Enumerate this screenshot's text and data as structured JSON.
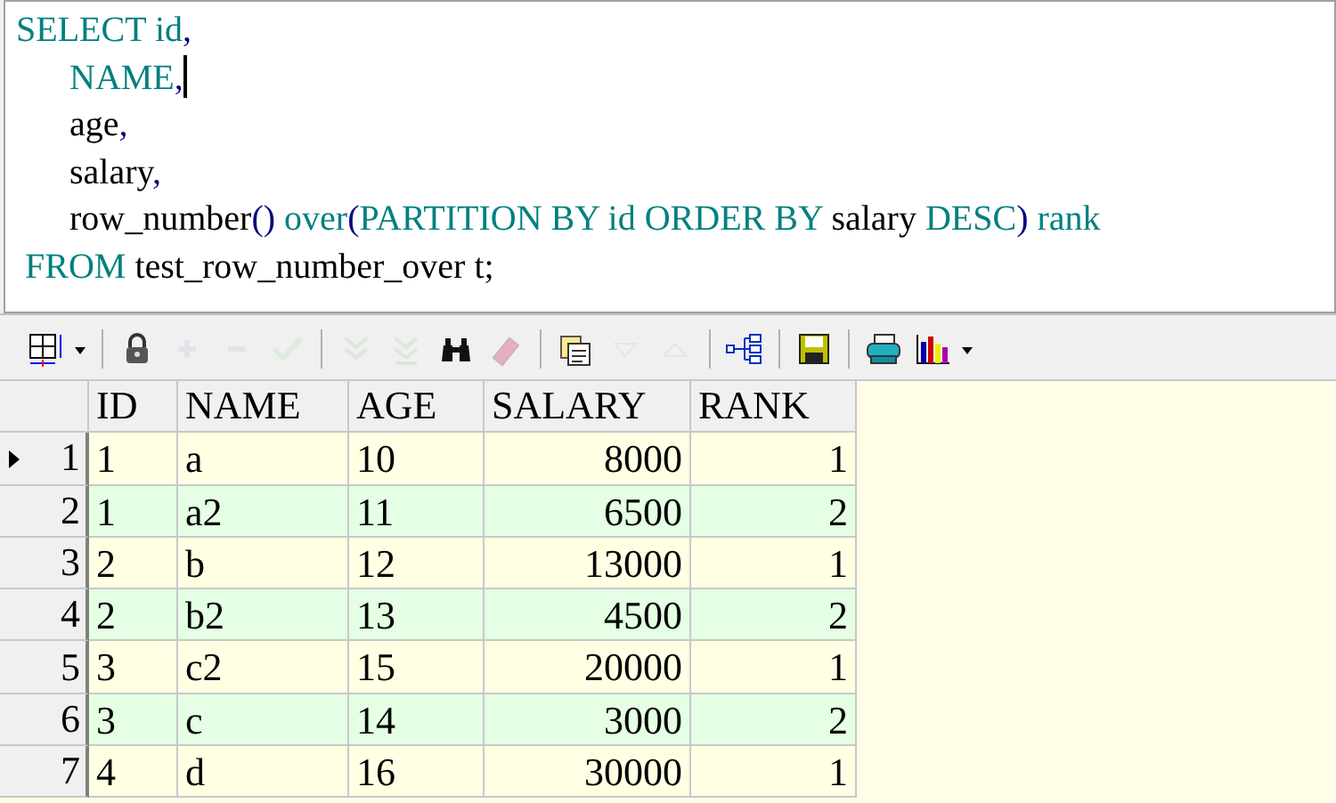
{
  "editor": {
    "lines": [
      {
        "caret": false,
        "tokens": [
          {
            "kind": "keyword",
            "text": "SELECT id"
          },
          {
            "kind": "punct",
            "text": ","
          }
        ]
      },
      {
        "caret": true,
        "tokens": [
          {
            "kind": "keyword",
            "text": "      NAME"
          },
          {
            "kind": "punct",
            "text": ","
          }
        ]
      },
      {
        "caret": false,
        "tokens": [
          {
            "kind": "ident",
            "text": "      age"
          },
          {
            "kind": "punct",
            "text": ","
          }
        ]
      },
      {
        "caret": false,
        "tokens": [
          {
            "kind": "ident",
            "text": "      salary"
          },
          {
            "kind": "punct",
            "text": ","
          }
        ]
      },
      {
        "caret": false,
        "tokens": [
          {
            "kind": "ident",
            "text": "      row_number"
          },
          {
            "kind": "punct",
            "text": "()"
          },
          {
            "kind": "keyword",
            "text": " over"
          },
          {
            "kind": "punct",
            "text": "("
          },
          {
            "kind": "keyword",
            "text": "PARTITION BY id ORDER BY"
          },
          {
            "kind": "ident",
            "text": " salary "
          },
          {
            "kind": "keyword",
            "text": "DESC"
          },
          {
            "kind": "punct",
            "text": ")"
          },
          {
            "kind": "keyword",
            "text": " rank"
          }
        ]
      },
      {
        "caret": false,
        "tokens": [
          {
            "kind": "keyword",
            "text": " FROM"
          },
          {
            "kind": "ident",
            "text": " test_row_number_over t;"
          }
        ]
      }
    ]
  },
  "toolbar": [
    {
      "kind": "grid",
      "disabled": false
    },
    {
      "kind": "dropdown",
      "disabled": false
    },
    {
      "kind": "separator"
    },
    {
      "kind": "lock",
      "disabled": false
    },
    {
      "kind": "plus",
      "disabled": true
    },
    {
      "kind": "minus",
      "disabled": true
    },
    {
      "kind": "check",
      "disabled": true
    },
    {
      "kind": "separator"
    },
    {
      "kind": "chevrons-down",
      "disabled": true
    },
    {
      "kind": "chevrons-down-bar",
      "disabled": true
    },
    {
      "kind": "binoculars",
      "disabled": false
    },
    {
      "kind": "eraser",
      "disabled": true
    },
    {
      "kind": "separator"
    },
    {
      "kind": "documents",
      "disabled": false
    },
    {
      "kind": "triangle-down",
      "disabled": true
    },
    {
      "kind": "triangle-up",
      "disabled": true
    },
    {
      "kind": "separator"
    },
    {
      "kind": "tree",
      "disabled": false
    },
    {
      "kind": "separator"
    },
    {
      "kind": "floppy",
      "disabled": false
    },
    {
      "kind": "separator"
    },
    {
      "kind": "printer",
      "disabled": false
    },
    {
      "kind": "bar-chart",
      "disabled": false
    },
    {
      "kind": "dropdown",
      "disabled": false
    }
  ],
  "table": {
    "columns": [
      {
        "label": "ID",
        "kind": "text"
      },
      {
        "label": "NAME",
        "kind": "text"
      },
      {
        "label": "AGE",
        "kind": "text"
      },
      {
        "label": "SALARY",
        "kind": "number"
      },
      {
        "label": "RANK",
        "kind": "number"
      }
    ],
    "rows": [
      {
        "number": "1",
        "current": true,
        "cells": [
          "1",
          "a",
          "10",
          "8000",
          "1"
        ]
      },
      {
        "number": "2",
        "current": false,
        "cells": [
          "1",
          "a2",
          "11",
          "6500",
          "2"
        ]
      },
      {
        "number": "3",
        "current": false,
        "cells": [
          "2",
          "b",
          "12",
          "13000",
          "1"
        ]
      },
      {
        "number": "4",
        "current": false,
        "cells": [
          "2",
          "b2",
          "13",
          "4500",
          "2"
        ]
      },
      {
        "number": "5",
        "current": false,
        "cells": [
          "3",
          "c2",
          "15",
          "20000",
          "1"
        ]
      },
      {
        "number": "6",
        "current": false,
        "cells": [
          "3",
          "c",
          "14",
          "3000",
          "2"
        ]
      },
      {
        "number": "7",
        "current": false,
        "cells": [
          "4",
          "d",
          "16",
          "30000",
          "1"
        ]
      }
    ]
  }
}
